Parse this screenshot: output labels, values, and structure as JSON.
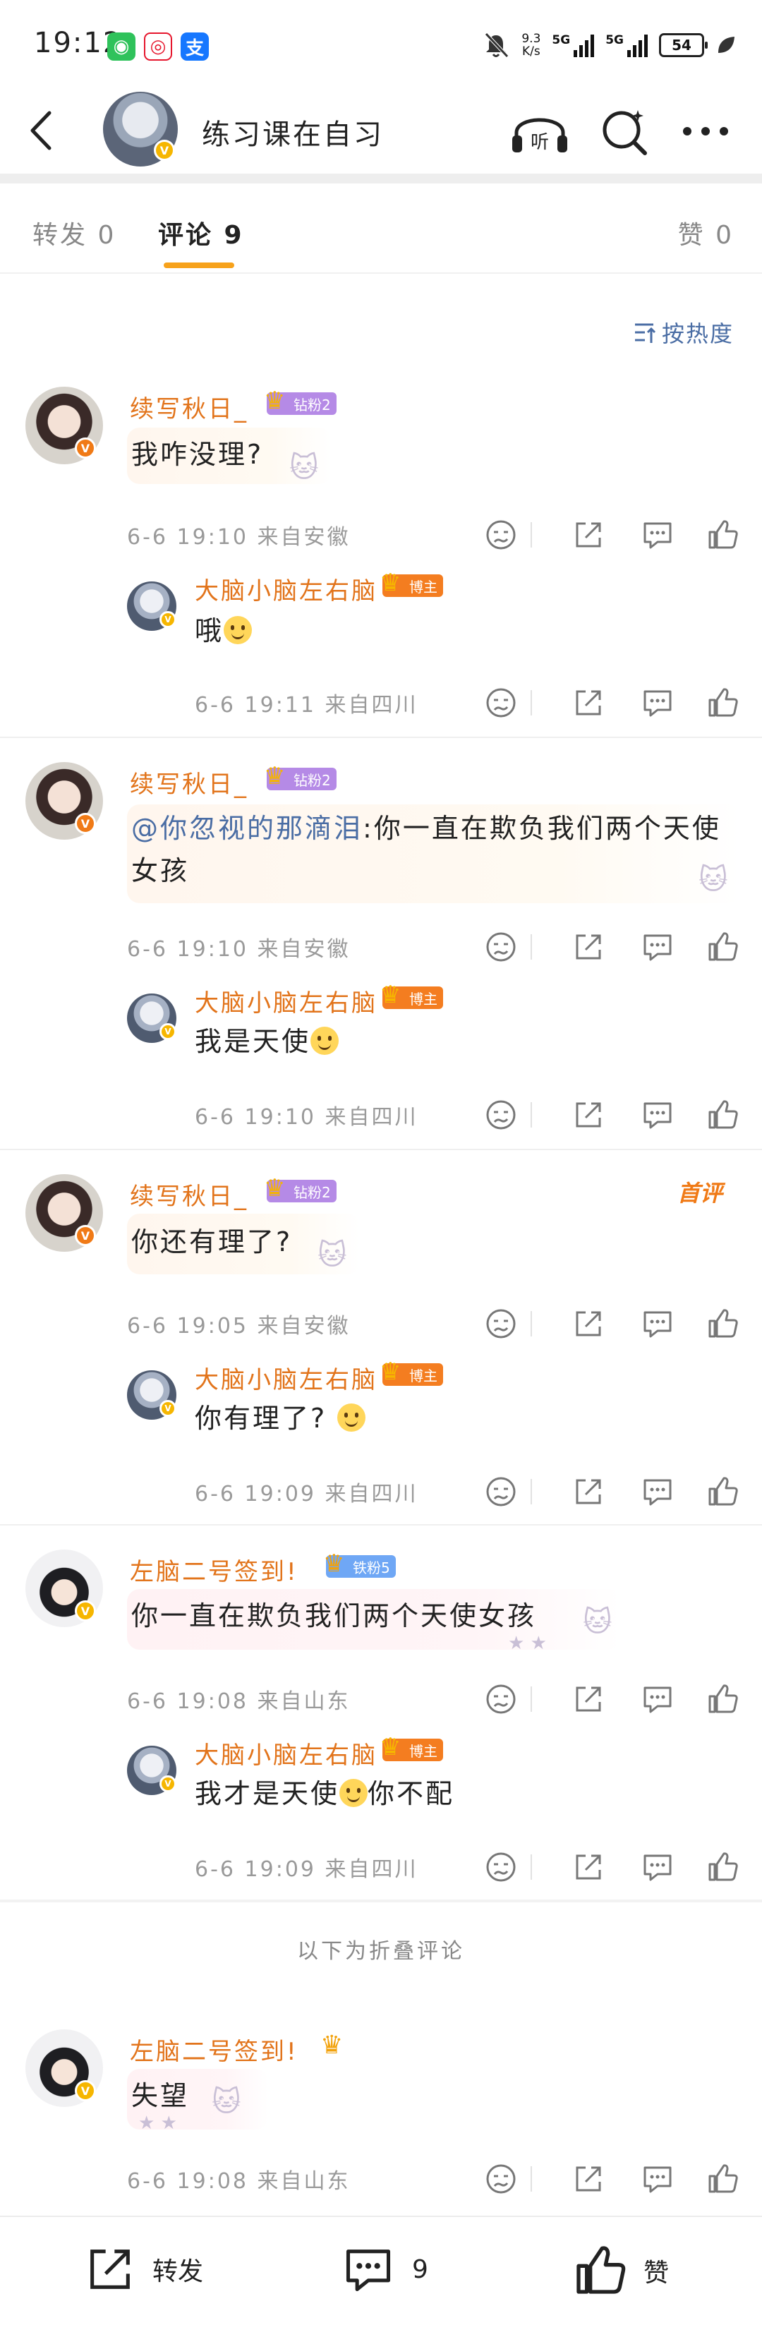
{
  "status_bar": {
    "time": "19:12",
    "network_speed_value": "9.3",
    "network_speed_unit": "K/s",
    "signal1_label": "5G",
    "signal2_label": "5G",
    "battery": "54"
  },
  "header": {
    "title": "练习课在自习"
  },
  "tabs": {
    "repost": "转发 0",
    "comments": "评论 9",
    "likes": "赞 0"
  },
  "sort_label": "按热度",
  "comments": [
    {
      "name": "续写秋日_",
      "badge": "钻粉2",
      "text": "我咋没理?",
      "meta": "6-6 19:10 来自安徽",
      "reply": {
        "name": "大脑小脑左右脑",
        "badge": "博主",
        "text": "哦",
        "meta": "6-6 19:11 来自四川"
      }
    },
    {
      "name": "续写秋日_",
      "badge": "钻粉2",
      "mention": "@你忽视的那滴泪",
      "text": ":你一直在欺负我们两个天使女孩",
      "meta": "6-6 19:10 来自安徽",
      "reply": {
        "name": "大脑小脑左右脑",
        "badge": "博主",
        "text": "我是天使",
        "meta": "6-6 19:10 来自四川"
      }
    },
    {
      "name": "续写秋日_",
      "badge": "钻粉2",
      "first_label": "首评",
      "text": "你还有理了?",
      "meta": "6-6 19:05 来自安徽",
      "reply": {
        "name": "大脑小脑左右脑",
        "badge": "博主",
        "text": "你有理了?",
        "meta": "6-6 19:09 来自四川"
      }
    },
    {
      "name": "左脑二号签到!",
      "badge": "铁粉5",
      "text": "你一直在欺负我们两个天使女孩",
      "meta": "6-6 19:08 来自山东",
      "reply": {
        "name": "大脑小脑左右脑",
        "badge": "博主",
        "text_before": "我才是天使",
        "text_after": "你不配",
        "meta": "6-6 19:09 来自四川"
      }
    }
  ],
  "folded_label": "以下为折叠评论",
  "folded_comment": {
    "name": "左脑二号签到!",
    "text": "失望",
    "meta": "6-6 19:08 来自山东"
  },
  "bottom_bar": {
    "repost": "转发",
    "comment_count": "9",
    "like": "赞"
  }
}
